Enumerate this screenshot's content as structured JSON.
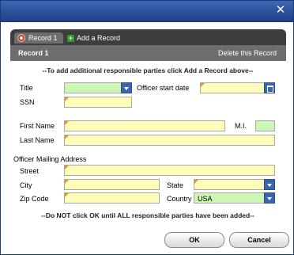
{
  "window": {
    "close_icon": "close-icon"
  },
  "tabs": {
    "active_label": "Record 1",
    "add_label": "Add a Record"
  },
  "record_bar": {
    "name": "Record 1",
    "delete_label": "Delete this Record"
  },
  "notes": {
    "top": "--To add additional responsible parties click Add a Record above--",
    "bottom": "--Do NOT click OK until ALL responsible parties have been added--"
  },
  "labels": {
    "title": "Title",
    "officer_start_date": "Officer start date",
    "ssn": "SSN",
    "first_name": "First Name",
    "mi": "M.I.",
    "last_name": "Last Name",
    "mailing_section": "Officer Mailing Address",
    "street": "Street",
    "city": "City",
    "state": "State",
    "zip": "Zip Code",
    "country": "Country"
  },
  "values": {
    "country": "USA"
  },
  "buttons": {
    "ok": "OK",
    "cancel": "Cancel"
  },
  "colors": {
    "titlebar": "#2a4f9a",
    "required_field": "#fefcb8",
    "select_field": "#cdf5b4",
    "required_marker": "#f0921e"
  }
}
